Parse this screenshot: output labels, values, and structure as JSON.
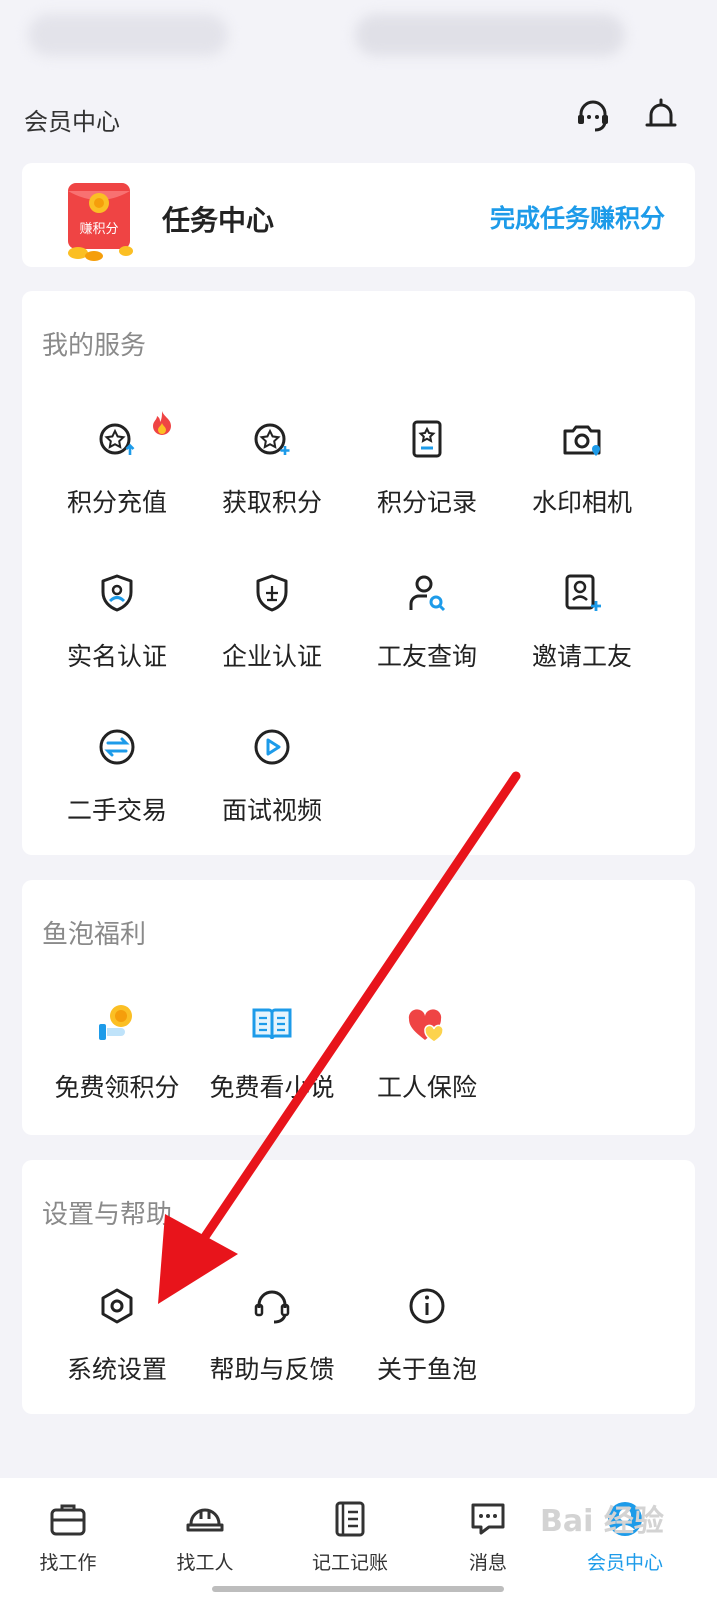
{
  "header": {
    "title": "会员中心"
  },
  "task_card": {
    "badge_text": "赚积分",
    "label": "任务中心",
    "link": "完成任务赚积分"
  },
  "services": {
    "title": "我的服务",
    "items": [
      {
        "label": "积分充值",
        "icon": "star-coin-up-icon"
      },
      {
        "label": "获取积分",
        "icon": "star-coin-plus-icon"
      },
      {
        "label": "积分记录",
        "icon": "record-book-icon"
      },
      {
        "label": "水印相机",
        "icon": "camera-location-icon"
      },
      {
        "label": "实名认证",
        "icon": "shield-user-icon"
      },
      {
        "label": "企业认证",
        "icon": "shield-company-icon"
      },
      {
        "label": "工友查询",
        "icon": "user-search-icon"
      },
      {
        "label": "邀请工友",
        "icon": "user-card-plus-icon"
      },
      {
        "label": "二手交易",
        "icon": "exchange-arrows-icon"
      },
      {
        "label": "面试视频",
        "icon": "play-circle-icon"
      }
    ]
  },
  "welfare": {
    "title": "鱼泡福利",
    "items": [
      {
        "label": "免费领积分",
        "icon": "coin-hand-icon"
      },
      {
        "label": "免费看小说",
        "icon": "open-book-icon"
      },
      {
        "label": "工人保险",
        "icon": "heart-insurance-icon"
      }
    ]
  },
  "settings": {
    "title": "设置与帮助",
    "items": [
      {
        "label": "系统设置",
        "icon": "hexagon-settings-icon"
      },
      {
        "label": "帮助与反馈",
        "icon": "headset-icon"
      },
      {
        "label": "关于鱼泡",
        "icon": "info-circle-icon"
      }
    ]
  },
  "tabbar": {
    "items": [
      {
        "label": "找工作",
        "icon": "briefcase-icon"
      },
      {
        "label": "找工人",
        "icon": "helmet-icon"
      },
      {
        "label": "记工记账",
        "icon": "notebook-icon"
      },
      {
        "label": "消息",
        "icon": "message-icon"
      },
      {
        "label": "会员中心",
        "icon": "member-icon",
        "active": true
      }
    ]
  },
  "watermark": "Bai 经验",
  "colors": {
    "accent": "#1d9be9",
    "arrow": "#e8141b",
    "badge": "#ef4444",
    "background": "#f3f3f8"
  }
}
